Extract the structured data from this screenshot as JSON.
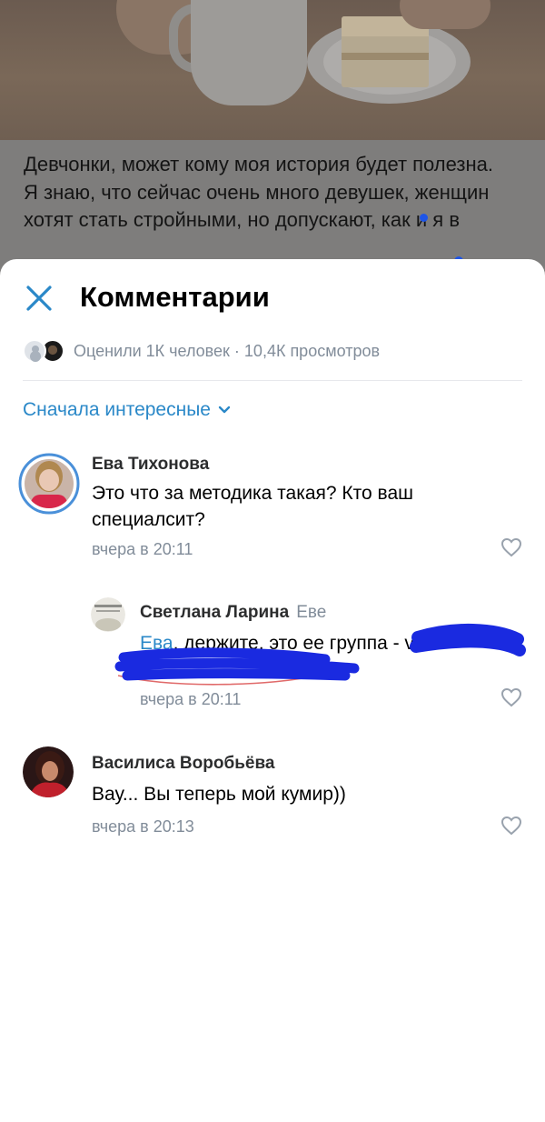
{
  "post": {
    "text_line1": "Девчонки, может кому моя история будет полезна.",
    "text_line2": "Я знаю, что сейчас очень много девушек, женщин хотят стать стройными, но допускают, как и я в"
  },
  "sheet": {
    "title": "Комментарии",
    "stats": "Оценили 1К человек · 10,4К просмотров",
    "sort_label": "Сначала интересные"
  },
  "comments": [
    {
      "author": "Ева Тихонова",
      "text": "Это что за методика такая? Кто ваш специалсит?",
      "time": "вчера в 20:11"
    },
    {
      "author": "Светлана Ларина",
      "reply_to": "Еве",
      "mention": "Ева",
      "text": ", держите, это ее группа - vk",
      "time": "вчера в 20:11"
    },
    {
      "author": "Василиса Воробьёва",
      "text": "Вау... Вы теперь мой кумир))",
      "time": "вчера в 20:13"
    }
  ],
  "colors": {
    "accent": "#2a88c8",
    "secondary_text": "#818c99",
    "scribble": "#1a2ae0",
    "story_ring": "#4a90d9"
  },
  "icons": [
    "close-icon",
    "chevron-down-icon",
    "heart-icon"
  ]
}
